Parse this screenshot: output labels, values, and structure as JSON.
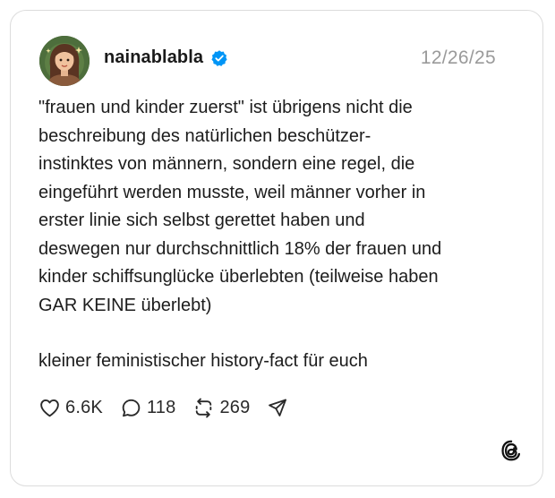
{
  "post": {
    "username": "nainablabla",
    "verified": true,
    "date": "12/26/25",
    "paragraphs": [
      "\"frauen und kinder zuerst\" ist übrigens nicht die\nbeschreibung des natürlichen beschützer-\ninstinktes von männern, sondern eine regel, die\neingeführt werden musste, weil männer vorher in\nerster linie sich selbst gerettet haben und\ndeswegen nur durchschnittlich 18% der frauen und\nkinder schiffsunglücke überlebten (teilweise haben\nGAR KEINE überlebt)",
      "kleiner feministischer history-fact für euch"
    ]
  },
  "actions": {
    "likes": "6.6K",
    "replies": "118",
    "reposts": "269"
  },
  "icons": {
    "like": "heart-icon",
    "reply": "comment-bubble-icon",
    "repost": "repost-arrows-icon",
    "share": "send-paper-plane-icon",
    "verified": "verified-badge-icon",
    "brand": "threads-logo-icon"
  },
  "colors": {
    "verified_badge": "#0095f6",
    "date_text": "#9a9a9a",
    "border": "#dcdcdc",
    "text": "#1c1c1c"
  }
}
